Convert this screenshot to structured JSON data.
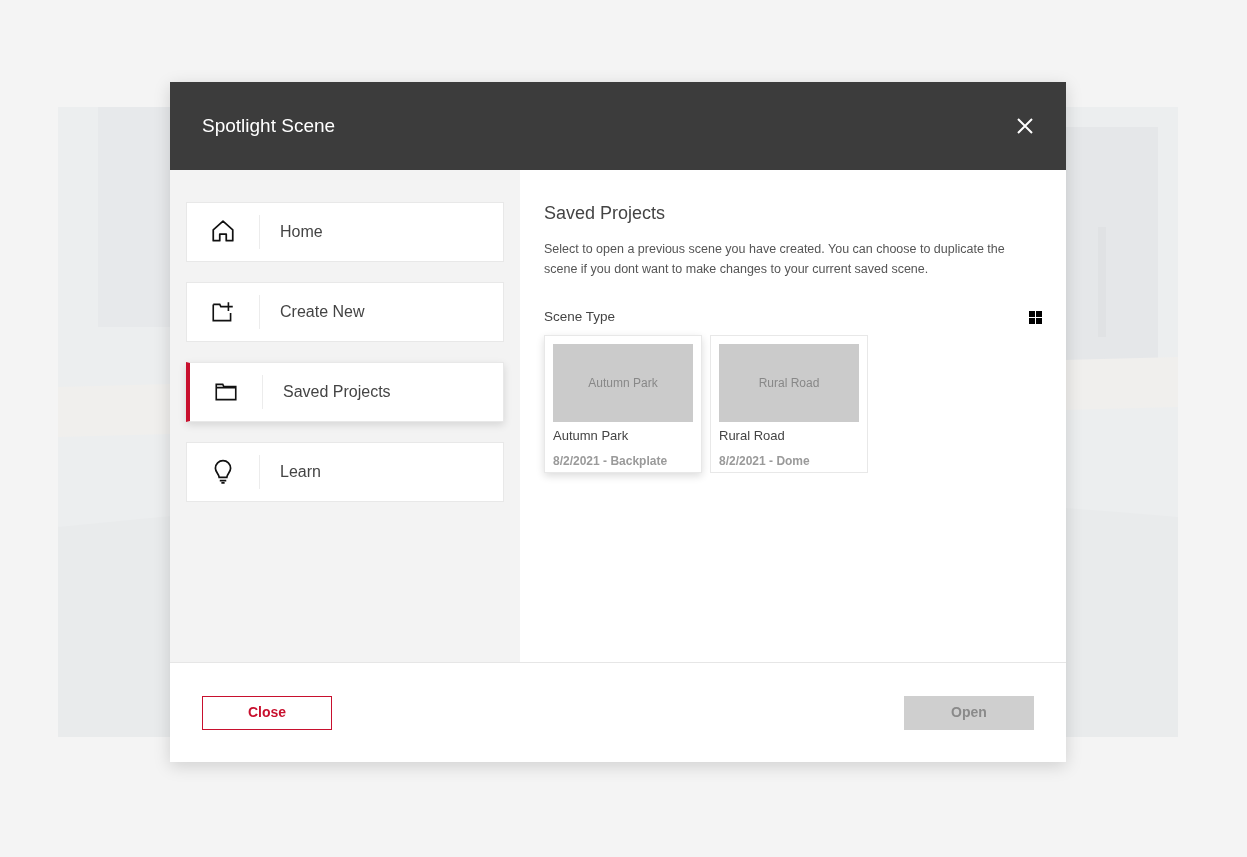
{
  "dialog": {
    "title": "Spotlight Scene"
  },
  "sidebar": {
    "items": [
      {
        "label": "Home",
        "kind": "home",
        "selected": false
      },
      {
        "label": "Create New",
        "kind": "create",
        "selected": false
      },
      {
        "label": "Saved Projects",
        "kind": "folder",
        "selected": true
      },
      {
        "label": "Learn",
        "kind": "learn",
        "selected": false
      }
    ]
  },
  "content": {
    "heading": "Saved Projects",
    "description": "Select to open a previous scene you have created. You can choose to duplicate the scene if you dont want to make changes to your current saved scene.",
    "section_label": "Scene Type",
    "projects": [
      {
        "thumbnail_label": "Autumn Park",
        "name": "Autumn Park",
        "meta": "8/2/2021 - Backplate",
        "selected": true
      },
      {
        "thumbnail_label": "Rural Road",
        "name": "Rural Road",
        "meta": "8/2/2021 - Dome",
        "selected": false
      }
    ]
  },
  "footer": {
    "close_button": "Close",
    "open_button": {
      "label": "Open",
      "disabled": true
    }
  }
}
